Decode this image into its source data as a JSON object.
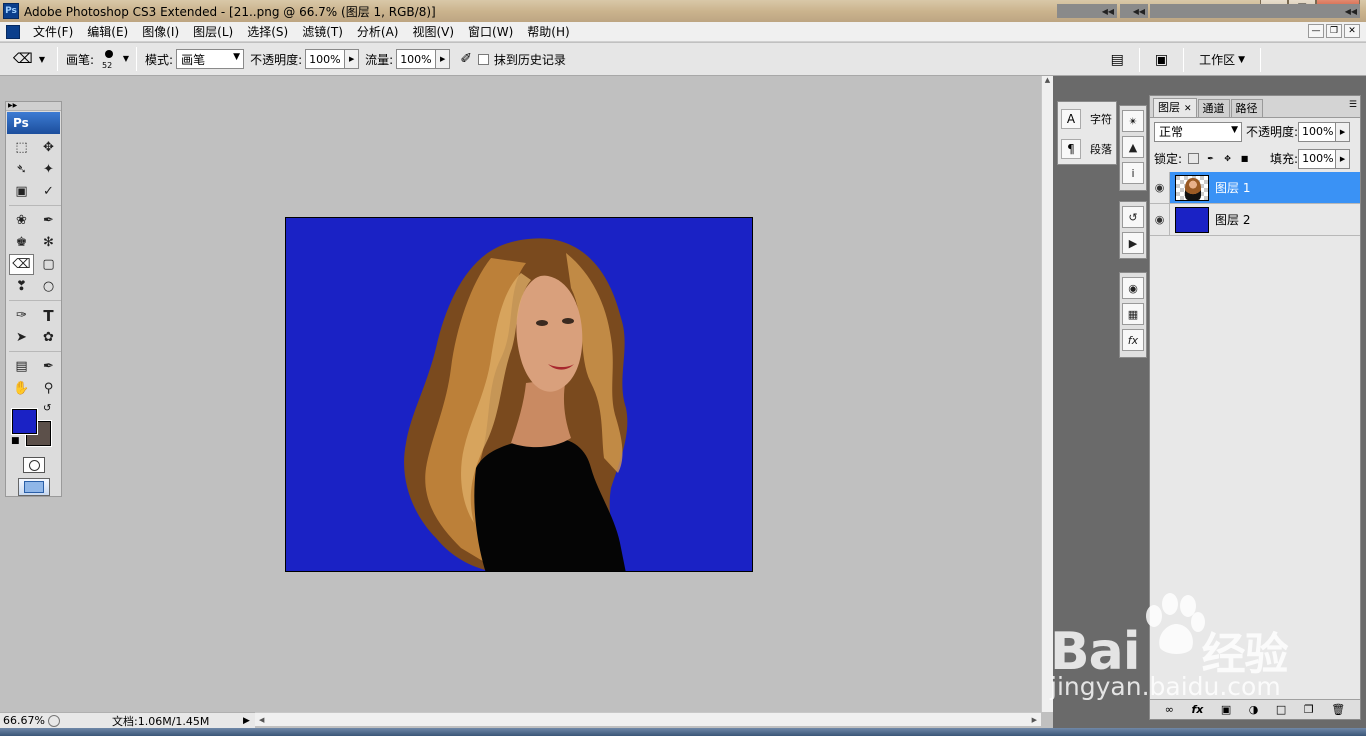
{
  "window": {
    "title": "Adobe Photoshop CS3 Extended - [21..png @ 66.7% (图层 1, RGB/8)]",
    "app_icon": "Ps"
  },
  "menu": [
    "文件(F)",
    "编辑(E)",
    "图像(I)",
    "图层(L)",
    "选择(S)",
    "滤镜(T)",
    "分析(A)",
    "视图(V)",
    "窗口(W)",
    "帮助(H)"
  ],
  "options": {
    "brush_label": "画笔:",
    "brush_size": "52",
    "mode_label": "模式:",
    "mode_value": "画笔",
    "opacity_label": "不透明度:",
    "opacity_value": "100%",
    "flow_label": "流量:",
    "flow_value": "100%",
    "erase_history_label": "抹到历史记录",
    "workspace_label": "工作区"
  },
  "toolbox": {
    "header": "Ps",
    "foreground_color": "#1a22c5",
    "background_color": "#5c504a"
  },
  "canvas": {
    "background_color": "#1a22c5"
  },
  "status": {
    "zoom": "66.67%",
    "doc_info": "文档:1.06M/1.45M"
  },
  "mini_panels": {
    "character_label": "字符",
    "paragraph_label": "段落"
  },
  "layers_panel": {
    "tabs": [
      "图层",
      "通道",
      "路径"
    ],
    "blend_mode": "正常",
    "opacity_label": "不透明度:",
    "opacity_value": "100%",
    "lock_label": "锁定:",
    "fill_label": "填充:",
    "fill_value": "100%",
    "layers": [
      {
        "name": "图层 1",
        "selected": true
      },
      {
        "name": "图层 2",
        "selected": false
      }
    ]
  },
  "watermark": {
    "logo": "Bai",
    "logo_cn": "经验",
    "url": "jingyan.baidu.com"
  }
}
